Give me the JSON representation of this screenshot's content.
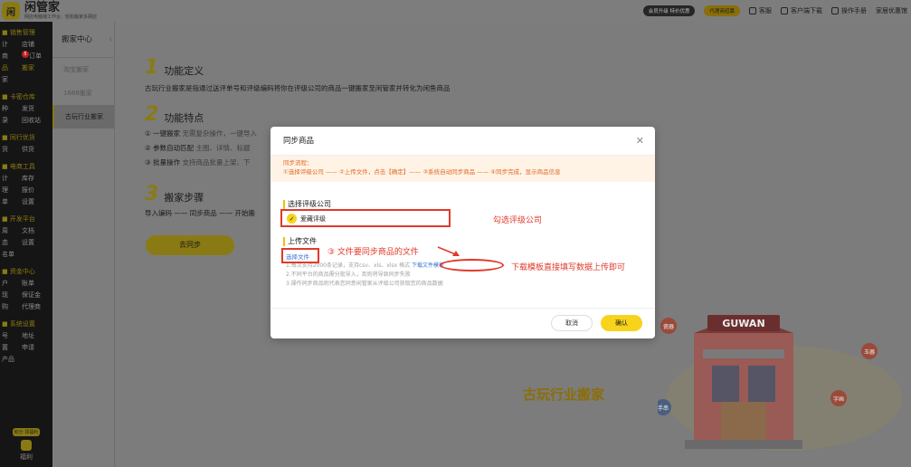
{
  "app": {
    "name": "闲管家",
    "subtitle": "网店电脑端工作台、轻松搬家多网店"
  },
  "topbar": {
    "vip": "会员升级 特价优惠",
    "dealer": "代理商招募",
    "links": [
      "客服",
      "客户端下载",
      "操作手册",
      "家居优惠馆"
    ]
  },
  "sidebar": {
    "groups": [
      {
        "title": "销售管理",
        "rows": [
          [
            "计",
            "店铺"
          ],
          [
            "商",
            "订单"
          ],
          [
            "品",
            "搬家"
          ],
          [
            "家",
            ""
          ]
        ]
      },
      {
        "title": "卡密仓库",
        "rows": [
          [
            "种",
            "发货"
          ],
          [
            "录",
            "回收站"
          ]
        ]
      },
      {
        "title": "同行优货",
        "rows": [
          [
            "货",
            "供货"
          ]
        ]
      },
      {
        "title": "电商工具",
        "rows": [
          [
            "计",
            "库存"
          ],
          [
            "理",
            "报价"
          ],
          [
            "单",
            "设置"
          ]
        ]
      },
      {
        "title": "开发平台",
        "rows": [
          [
            "周",
            "文档"
          ],
          [
            "态",
            "设置"
          ],
          [
            "名单",
            ""
          ]
        ]
      },
      {
        "title": "资金中心",
        "rows": [
          [
            "户",
            "账单"
          ],
          [
            "现",
            "保证金"
          ],
          [
            "购",
            "代理商"
          ]
        ]
      },
      {
        "title": "系统设置",
        "rows": [
          [
            "号",
            "地址"
          ],
          [
            "置",
            "申请"
          ],
          [
            "产品",
            ""
          ]
        ]
      }
    ],
    "badge": "5",
    "bottom_badge": "积分 领福利",
    "bottom_label": "福利"
  },
  "subnav": {
    "title": "搬家中心",
    "items": [
      "淘宝搬家",
      "1688搬家",
      "古玩行业搬家"
    ],
    "active": 2
  },
  "main": {
    "s1": {
      "num": "1",
      "title": "功能定义",
      "text": "古玩行业搬家是指通过送评单号和评级编码将你在评级公司的商品一键搬家至闲管家并转化为闲鱼商品"
    },
    "s2": {
      "num": "2",
      "title": "功能特点",
      "lines": [
        {
          "head": "① 一键搬家",
          "rest": "无需复杂操作，一键导入"
        },
        {
          "head": "② 参数自动匹配",
          "rest": "主图、详情、标题"
        },
        {
          "head": "③ 批量操作",
          "rest": "支持商品批量上架、下"
        }
      ]
    },
    "s3": {
      "num": "3",
      "title": "搬家步骤",
      "text": "导入编码 —— 同步商品 —— 开始搬"
    },
    "sync_button": "去同步",
    "illustration_title": "古玩行业搬家",
    "shop_sign": "GUWAN",
    "bubbles": [
      "瓷器",
      "玉器",
      "钱币",
      "字画",
      "手串"
    ]
  },
  "modal": {
    "title": "同步商品",
    "flow_title": "同步流程：",
    "flow_steps": "①选择评级公司 —— ②上传文件，点击【确定】—— ③系统自动同步商品 —— ④同步完成，显示商品信息",
    "company_label": "选择评级公司",
    "company_value": "爱藏评级",
    "upload_label": "上传文件",
    "choose_file": "选择文件",
    "tip1_pre": "1.每次支持2000条记录，支持csv、xls、xlsx 格式",
    "tip1_link": "下载文件模板",
    "tip2": "2.不同平台的商品需分批导入，否则将导致同步失败",
    "tip3": "3.操作同步商品则代表您同意闲管家从评级公司获取您的商品数据",
    "cancel": "取消",
    "confirm": "确认"
  },
  "annotations": {
    "select_company": "勾选评级公司",
    "upload_file": "③ 文件要同步商品的文件",
    "download_template": "下载模板直接填写数据上传即可"
  }
}
